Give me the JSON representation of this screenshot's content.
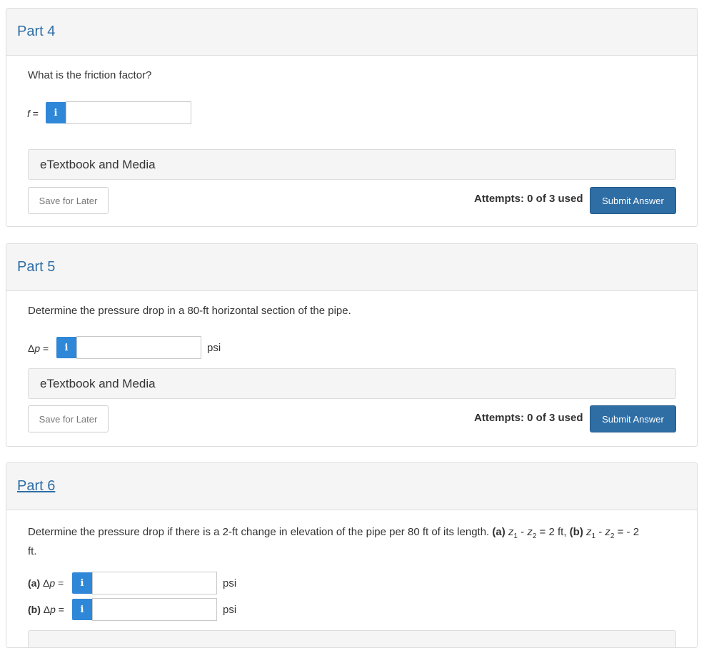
{
  "colors": {
    "accent": "#2f6ea5",
    "info_button": "#2f87d8",
    "panel_bg": "#f5f5f5"
  },
  "part4": {
    "title": "Part 4",
    "question": "What is the friction factor?",
    "var_label": "f",
    "var_eq": " =",
    "info_icon": "i",
    "value": "",
    "etextbook": "eTextbook and Media",
    "save_label": "Save for Later",
    "attempts": "Attempts: 0 of 3 used",
    "submit_label": "Submit Answer"
  },
  "part5": {
    "title": "Part 5",
    "question": "Determine the pressure drop in a 80-ft horizontal section of the pipe.",
    "var_prefix": "Δ",
    "var_label": "p",
    "var_eq": " =",
    "info_icon": "i",
    "value": "",
    "unit": "psi",
    "etextbook": "eTextbook and Media",
    "save_label": "Save for Later",
    "attempts": "Attempts: 0 of 3 used",
    "submit_label": "Submit Answer"
  },
  "part6": {
    "title": "Part 6",
    "question_text": "Determine the pressure drop if there is a 2-ft change in elevation of the pipe per 80 ft of its length.",
    "part_a_tag": "(a)",
    "part_a_expr_z1": "z",
    "part_a_sub1": "1",
    "part_a_minus": " - ",
    "part_a_expr_z2": "z",
    "part_a_sub2": "2",
    "part_a_rhs": " = 2 ft, ",
    "part_b_tag": "(b)",
    "part_b_rhs": " = - 2",
    "question_end": "ft.",
    "a_label_tag": "(a) ",
    "b_label_tag": "(b) ",
    "var_prefix": "Δ",
    "var_label": "p",
    "var_eq": " =",
    "info_icon": "i",
    "a_value": "",
    "b_value": "",
    "unit": "psi"
  }
}
